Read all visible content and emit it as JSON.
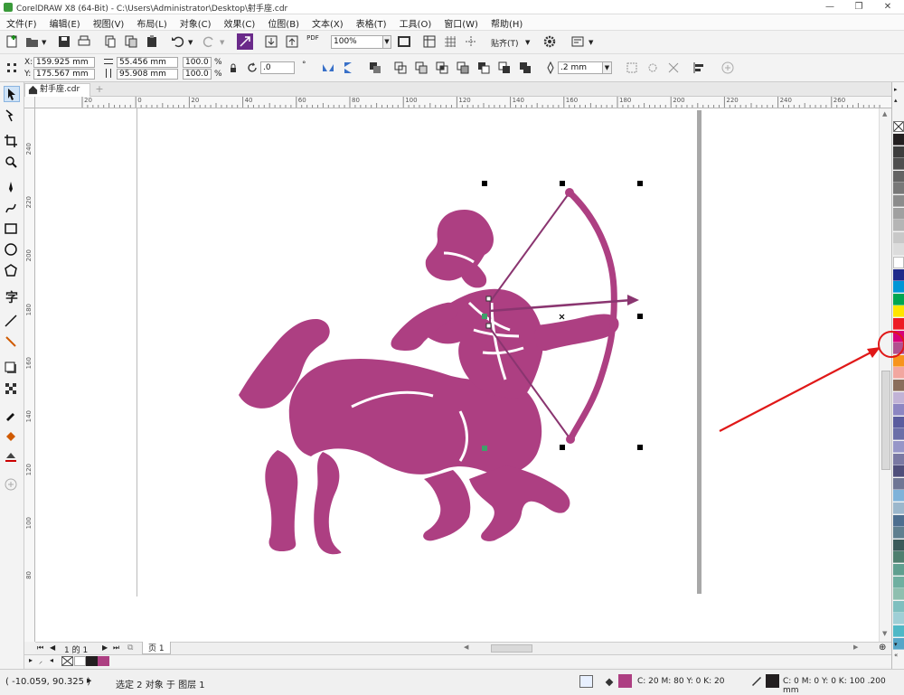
{
  "window": {
    "title": "CorelDRAW X8 (64-Bit) - C:\\Users\\Administrator\\Desktop\\射手座.cdr",
    "min": "—",
    "restore": "❐",
    "close": "✕"
  },
  "menu": [
    "文件(F)",
    "编辑(E)",
    "视图(V)",
    "布局(L)",
    "对象(C)",
    "效果(C)",
    "位图(B)",
    "文本(X)",
    "表格(T)",
    "工具(O)",
    "窗口(W)",
    "帮助(H)"
  ],
  "toolbar": {
    "zoom": "100%",
    "snap_label": "贴齐(T)",
    "pdf_label": "PDF"
  },
  "propbar": {
    "x_label": "X:",
    "x": "159.925 mm",
    "y_label": "Y:",
    "y": "175.567 mm",
    "w": "55.456 mm",
    "h": "95.908 mm",
    "sx": "100.0",
    "sy": "100.0",
    "pct": "%",
    "angle": ".0",
    "deg": "°",
    "outline": ".2 mm"
  },
  "doc_tab": "射手座.cdr",
  "ruler_h": [
    "20",
    "0",
    "20",
    "40",
    "60",
    "80",
    "100",
    "120",
    "140",
    "160",
    "180",
    "200",
    "220",
    "240",
    "260"
  ],
  "ruler_v": [
    "240",
    "220",
    "200",
    "180",
    "160",
    "140",
    "120",
    "100",
    "80"
  ],
  "pager": {
    "first": "⏮",
    "prev": "◀",
    "page_of": "1 的 1",
    "next": "▶",
    "last": "⏭",
    "page_tab": "页 1"
  },
  "status": {
    "coords": "( -10.059, 90.325 )",
    "selection": "选定 2 对象 于 图层 1",
    "fill": "C: 20 M: 80 Y: 0 K: 20",
    "outline": "C: 0 M: 0 Y: 0 K: 100  .200 mm"
  },
  "colors": {
    "fill": "#ad3f82",
    "annotation": "#e01818",
    "accent": "#3399ff"
  },
  "palette": [
    "#231f20",
    "#3d3d3d",
    "#4f4f4f",
    "#636363",
    "#787878",
    "#8c8c8c",
    "#a0a0a0",
    "#b5b5b5",
    "#c8c8c8",
    "#dcdcdc",
    "#ffffff",
    "#1f2a8a",
    "#0096d6",
    "#00a651",
    "#ffe600",
    "#ed1c24",
    "#d6007a",
    "#b1508f",
    "#f7941d",
    "#f2a7a0",
    "#8a6d5b",
    "#c1b3d6",
    "#8c86c2",
    "#5a5c9e",
    "#6b6fa8",
    "#9696c8",
    "#7a79a3",
    "#4f4e7a",
    "#6f7694",
    "#7fb2d9",
    "#9bb7cc",
    "#4d6e8f",
    "#5f7f8f",
    "#3b5a5a",
    "#4f7f6f",
    "#5f9f8f",
    "#6fafa0",
    "#8fbfaf",
    "#7fbfbf",
    "#9fcfd6",
    "#4fb8c6",
    "#56a6c8"
  ],
  "icons": [
    "new-icon",
    "open-icon",
    "save-icon",
    "print-icon",
    "undo-icon",
    "redo-icon",
    "import-icon",
    "export-icon",
    "pdf-icon",
    "fullscreen-icon",
    "gear-icon",
    "pick-tool-icon",
    "shape-tool-icon",
    "crop-tool-icon",
    "zoom-tool-icon",
    "freehand-tool-icon",
    "artistic-media-icon",
    "rectangle-tool-icon",
    "ellipse-tool-icon",
    "polygon-tool-icon",
    "text-tool-icon",
    "parallel-dimension-icon",
    "connector-tool-icon",
    "drop-shadow-icon",
    "transparency-icon",
    "eyedropper-icon",
    "interactive-fill-icon",
    "smart-fill-icon",
    "add-icon",
    "home-icon",
    "no-color-icon",
    "close-icon"
  ]
}
